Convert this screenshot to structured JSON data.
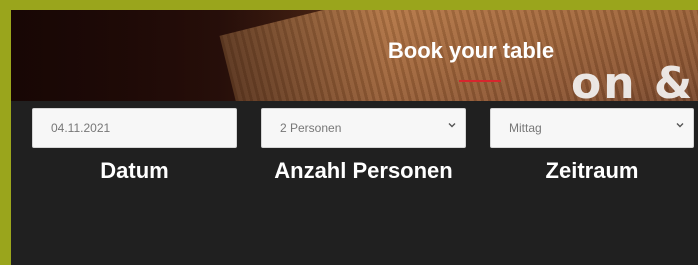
{
  "hero": {
    "title": "Book your table",
    "sign_text": "on &",
    "accent_color": "#d7262e"
  },
  "form": {
    "date": {
      "value": "04.11.2021",
      "label": "Datum"
    },
    "persons": {
      "value": "2 Personen",
      "label": "Anzahl Personen",
      "icon": "chevron-down-icon"
    },
    "period": {
      "value": "Mittag",
      "label": "Zeitraum",
      "icon": "chevron-down-icon"
    }
  },
  "colors": {
    "outer_border": "#9aa51c",
    "panel_bg": "#202020",
    "field_bg": "#f7f7f7"
  }
}
